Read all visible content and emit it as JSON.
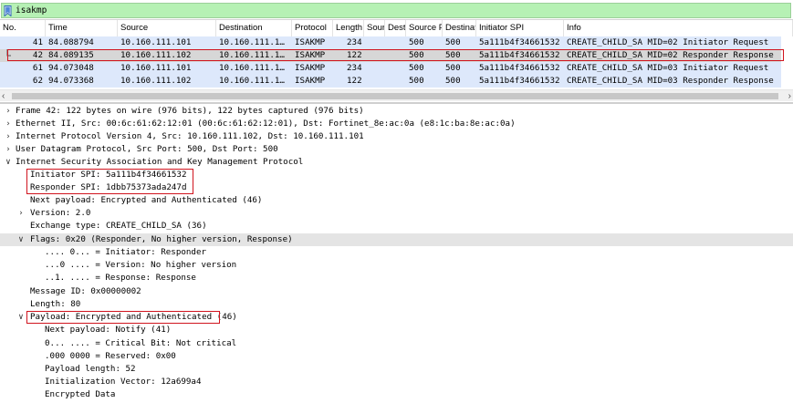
{
  "filter": {
    "value": "isakmp"
  },
  "packet_list": {
    "columns": [
      "No.",
      "Time",
      "Source",
      "Destination",
      "Protocol",
      "Length",
      "Sour",
      "Dest",
      "Source P",
      "Destinat",
      "Initiator SPI",
      "Info"
    ],
    "rows": [
      {
        "no": "41",
        "time": "84.088794",
        "source": "10.160.111.101",
        "destination": "10.160.111.1…",
        "protocol": "ISAKMP",
        "length": "234",
        "sport": "500",
        "dport": "500",
        "spi": "5a111b4f34661532",
        "info": "CREATE_CHILD_SA MID=02 Initiator Request",
        "selected": false
      },
      {
        "no": "42",
        "time": "84.089135",
        "source": "10.160.111.102",
        "destination": "10.160.111.1…",
        "protocol": "ISAKMP",
        "length": "122",
        "sport": "500",
        "dport": "500",
        "spi": "5a111b4f34661532",
        "info": "CREATE_CHILD_SA MID=02 Responder Response",
        "selected": true
      },
      {
        "no": "61",
        "time": "94.073048",
        "source": "10.160.111.101",
        "destination": "10.160.111.1…",
        "protocol": "ISAKMP",
        "length": "234",
        "sport": "500",
        "dport": "500",
        "spi": "5a111b4f34661532",
        "info": "CREATE_CHILD_SA MID=03 Initiator Request",
        "selected": false
      },
      {
        "no": "62",
        "time": "94.073368",
        "source": "10.160.111.102",
        "destination": "10.160.111.1…",
        "protocol": "ISAKMP",
        "length": "122",
        "sport": "500",
        "dport": "500",
        "spi": "5a111b4f34661532",
        "info": "CREATE_CHILD_SA MID=03 Responder Response",
        "selected": false
      }
    ]
  },
  "details": {
    "frame": "Frame 42: 122 bytes on wire (976 bits), 122 bytes captured (976 bits)",
    "ethernet": "Ethernet II, Src: 00:6c:61:62:12:01 (00:6c:61:62:12:01), Dst: Fortinet_8e:ac:0a (e8:1c:ba:8e:ac:0a)",
    "ip": "Internet Protocol Version 4, Src: 10.160.111.102, Dst: 10.160.111.101",
    "udp": "User Datagram Protocol, Src Port: 500, Dst Port: 500",
    "isakmp": "Internet Security Association and Key Management Protocol",
    "initiator_spi": "Initiator SPI: 5a111b4f34661532",
    "responder_spi": "Responder SPI: 1dbb75373ada247d",
    "next_payload": "Next payload: Encrypted and Authenticated (46)",
    "version": "Version: 2.0",
    "exchange_type": "Exchange type: CREATE_CHILD_SA (36)",
    "flags": "Flags: 0x20 (Responder, No higher version, Response)",
    "flag_initiator": ".... 0... = Initiator: Responder",
    "flag_version": "...0 .... = Version: No higher version",
    "flag_response": "..1. .... = Response: Response",
    "message_id": "Message ID: 0x00000002",
    "length": "Length: 80",
    "payload_label": "Payload: Encrypted and Authenticated",
    "payload_suffix": " (46)",
    "payload_next": "Next payload: Notify (41)",
    "critical_bit": "0... .... = Critical Bit: Not critical",
    "reserved": ".000 0000 = Reserved: 0x00",
    "payload_length": "Payload length: 52",
    "iv": "Initialization Vector: 12a699a4",
    "encrypted_data": "Encrypted Data"
  },
  "colors": {
    "filter_valid": "#b6f1b4",
    "row_bg": "#dde8fb",
    "row_selected": "#d7d7d7",
    "highlight_box": "#d0141e"
  }
}
